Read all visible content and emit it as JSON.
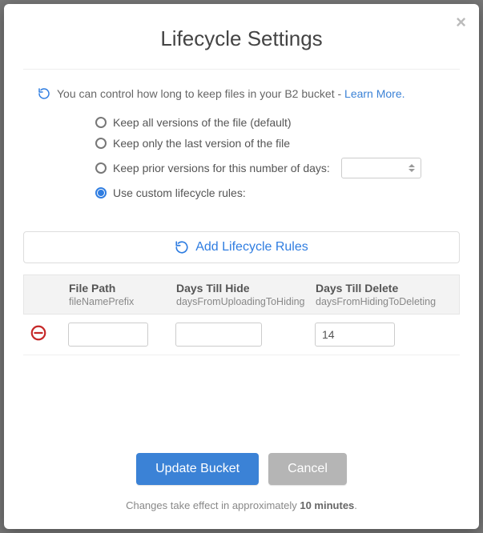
{
  "modal": {
    "title": "Lifecycle Settings",
    "close_glyph": "×"
  },
  "intro": {
    "text": "You can control how long to keep files in your B2 bucket - ",
    "link": "Learn More."
  },
  "options": {
    "keep_all": "Keep all versions of the file (default)",
    "keep_last": "Keep only the last version of the file",
    "keep_prior": "Keep prior versions for this number of days:",
    "custom": "Use custom lifecycle rules:",
    "prior_days_value": "",
    "selected": "custom"
  },
  "add_rules": {
    "label": "Add Lifecycle Rules"
  },
  "table": {
    "headers": {
      "file_path": {
        "title": "File Path",
        "sub": "fileNamePrefix"
      },
      "hide": {
        "title": "Days Till Hide",
        "sub": "daysFromUploadingToHiding"
      },
      "del": {
        "title": "Days Till Delete",
        "sub": "daysFromHidingToDeleting"
      }
    },
    "rows": [
      {
        "file_path": "",
        "days_hide": "",
        "days_delete": "14"
      }
    ]
  },
  "actions": {
    "update": "Update Bucket",
    "cancel": "Cancel"
  },
  "footnote": {
    "prefix": "Changes take effect in approximately ",
    "bold": "10 minutes",
    "suffix": "."
  }
}
